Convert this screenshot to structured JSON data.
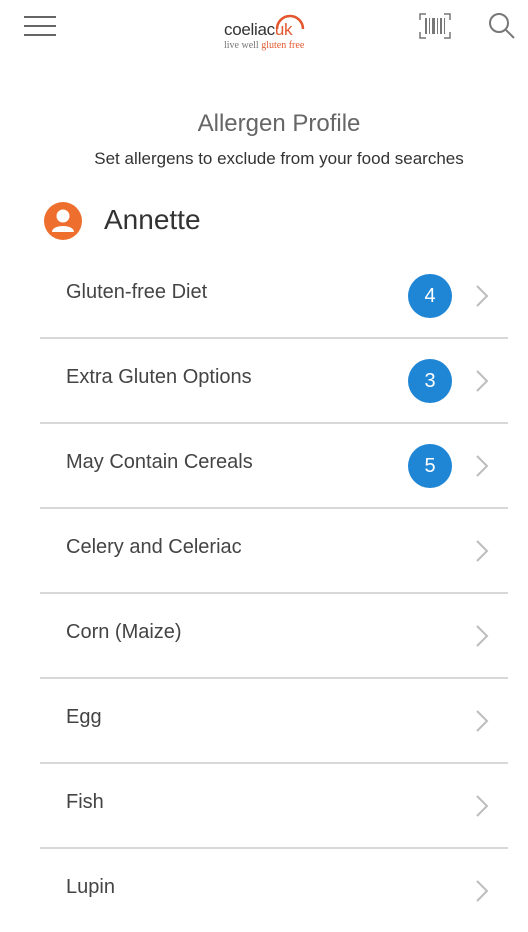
{
  "header": {
    "logo": {
      "text_main": "coeliac",
      "text_accent": "uk",
      "tagline_main": "live well",
      "tagline_accent": "gluten free"
    },
    "menu_icon": "hamburger-icon",
    "barcode_icon": "barcode-scan-icon",
    "search_icon": "search-icon"
  },
  "page": {
    "title": "Allergen Profile",
    "subtitle": "Set allergens to exclude from your food searches"
  },
  "profile": {
    "name": "Annette",
    "avatar_icon": "user-icon"
  },
  "allergens": [
    {
      "label": "Gluten-free Diet",
      "count": "4"
    },
    {
      "label": "Extra Gluten Options",
      "count": "3"
    },
    {
      "label": "May Contain Cereals",
      "count": "5"
    },
    {
      "label": "Celery and Celeriac",
      "count": null
    },
    {
      "label": "Corn (Maize)",
      "count": null
    },
    {
      "label": "Egg",
      "count": null
    },
    {
      "label": "Fish",
      "count": null
    },
    {
      "label": "Lupin",
      "count": null
    }
  ],
  "colors": {
    "accent_orange": "#ee6f2d",
    "badge_blue": "#1f86d6",
    "divider": "#d8d8d8"
  }
}
